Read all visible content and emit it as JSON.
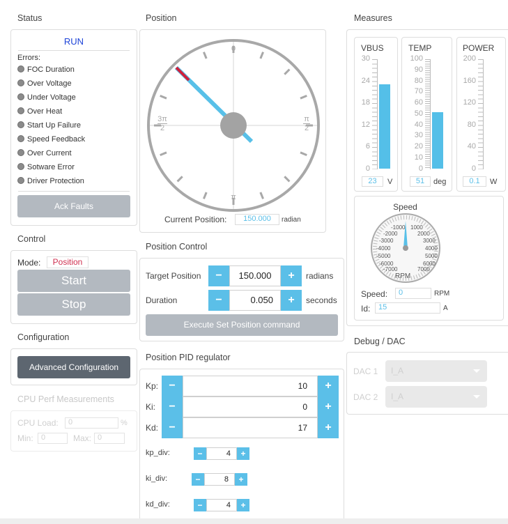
{
  "status": {
    "title": "Status",
    "run_state": "RUN",
    "errors_label": "Errors:",
    "errors": [
      "FOC Duration",
      "Over Voltage",
      "Under Voltage",
      "Over Heat",
      "Start Up Failure",
      "Speed Feedback",
      "Over Current",
      "Sotware Error",
      "Driver Protection"
    ],
    "ack_label": "Ack Faults"
  },
  "control": {
    "title": "Control",
    "mode_label": "Mode:",
    "mode_value": "Position",
    "start_label": "Start",
    "stop_label": "Stop"
  },
  "configuration": {
    "title": "Configuration",
    "advanced_label": "Advanced Configuration"
  },
  "cpu": {
    "title": "CPU Perf Measurements",
    "load_label": "CPU Load:",
    "load_value": "0",
    "load_unit": "%",
    "min_label": "Min:",
    "min_value": "0",
    "max_label": "Max:",
    "max_value": "0"
  },
  "position": {
    "title": "Position",
    "dial_labels": {
      "top": "0",
      "bottom": "π",
      "right_num": "π",
      "right_den": "2",
      "left_num": "3π",
      "left_den": "2"
    },
    "current_label": "Current Position:",
    "current_value": "150.000",
    "current_unit": "radian"
  },
  "position_control": {
    "title": "Position Control",
    "target_label": "Target Position",
    "target_value": "150.000",
    "target_unit": "radians",
    "duration_label": "Duration",
    "duration_value": "0.050",
    "duration_unit": "seconds",
    "execute_label": "Execute Set Position command",
    "minus": "−",
    "plus": "+"
  },
  "pid": {
    "title": "Position PID regulator",
    "kp_label": "Kp:",
    "kp_value": "10",
    "ki_label": "Ki:",
    "ki_value": "0",
    "kd_label": "Kd:",
    "kd_value": "17",
    "kp_div_label": "kp_div:",
    "kp_div_value": "4",
    "ki_div_label": "ki_div:",
    "ki_div_value": "8",
    "kd_div_label": "kd_div:",
    "kd_div_value": "4"
  },
  "measures": {
    "title": "Measures",
    "vbus": {
      "label": "VBUS",
      "ticks": [
        "30",
        "24",
        "18",
        "12",
        "6",
        "0"
      ],
      "value": "23",
      "unit": "V",
      "level": 0.767
    },
    "temp": {
      "label": "TEMP",
      "ticks": [
        "100",
        "90",
        "80",
        "70",
        "60",
        "50",
        "40",
        "30",
        "20",
        "10",
        "0"
      ],
      "value": "51",
      "unit": "deg",
      "level": 0.51
    },
    "power": {
      "label": "POWER",
      "ticks": [
        "200",
        "160",
        "120",
        "80",
        "40",
        "0"
      ],
      "value": "0.1",
      "unit": "W",
      "level": 0.0005
    },
    "speed": {
      "title": "Speed",
      "unit_label": "RPM",
      "scale": [
        "-1000",
        "1000",
        "-2000",
        "2000",
        "-3000",
        "3000",
        "-4000",
        "4000",
        "-5000",
        "5000",
        "-6000",
        "6000",
        "-7000",
        "7000"
      ],
      "speed_label": "Speed:",
      "speed_value": "0",
      "speed_unit": "RPM",
      "id_label": "Id:",
      "id_value": "15",
      "id_unit": "A"
    }
  },
  "debug": {
    "title": "Debug / DAC",
    "dac1_label": "DAC 1",
    "dac1_value": "I_A",
    "dac2_label": "DAC 2",
    "dac2_value": "I_A"
  },
  "colors": {
    "accent": "#5bbfe8",
    "run": "#1e44d8",
    "mode": "#d03050",
    "needle_red": "#d0203c"
  }
}
